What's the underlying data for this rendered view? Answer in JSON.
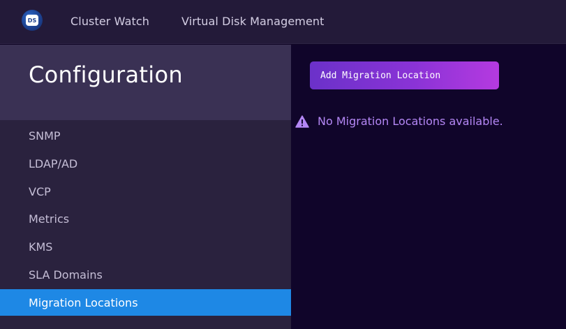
{
  "header": {
    "logo_text": "DS",
    "nav": [
      "Cluster Watch",
      "Virtual Disk Management"
    ]
  },
  "sidebar": {
    "title": "Configuration",
    "items": [
      {
        "label": "SNMP"
      },
      {
        "label": "LDAP/AD"
      },
      {
        "label": "VCP"
      },
      {
        "label": "Metrics"
      },
      {
        "label": "KMS"
      },
      {
        "label": "SLA Domains"
      },
      {
        "label": "Migration Locations",
        "active": true
      }
    ]
  },
  "main": {
    "add_button_label": "Add Migration Location",
    "empty_message": "No Migration Locations available.",
    "empty_icon": "warning-triangle-icon"
  },
  "colors": {
    "topbar": "#231a39",
    "sidebar": "#2a223e",
    "sidebar_header": "#3a3154",
    "active_item": "#1e88e5",
    "main_background": "#10052a",
    "button_gradient_start": "#6b31c9",
    "button_gradient_end": "#b53ae0",
    "notice_text": "#b487f5"
  }
}
